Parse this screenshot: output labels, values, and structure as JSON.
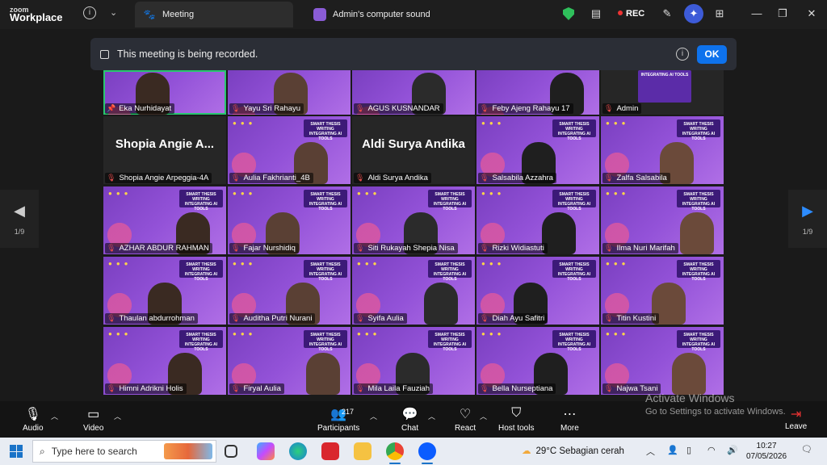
{
  "app": {
    "brand_small": "zoom",
    "brand": "Workplace"
  },
  "tabs": [
    {
      "label": "Meeting",
      "icon": "paw-icon",
      "active": true
    },
    {
      "label": "Admin's computer sound",
      "icon": "share-sound-icon",
      "active": false
    }
  ],
  "topbar": {
    "rec_label": "REC"
  },
  "recording_banner": {
    "message": "This meeting is being recorded.",
    "ok_label": "OK"
  },
  "pager": {
    "left": "1/9",
    "right": "1/9"
  },
  "tile_banner": "SMART THESIS WRITING INTEGRATING AI TOOLS",
  "participants": [
    {
      "name": "Eka Nurhidayat",
      "kind": "camera",
      "speaking": true,
      "pinned": true
    },
    {
      "name": "Yayu Sri Rahayu",
      "kind": "camera"
    },
    {
      "name": "AGUS KUSNANDAR",
      "kind": "camera"
    },
    {
      "name": "Feby Ajeng Rahayu 17",
      "kind": "camera"
    },
    {
      "name": "Admin",
      "kind": "poster",
      "poster_text": "INTEGRATING AI TOOLS"
    },
    {
      "name": "Shopia Angie Arpeggia-4A",
      "kind": "name-only",
      "display": "Shopia Angie A..."
    },
    {
      "name": "Aulia Fakhrianti_4B",
      "kind": "camera"
    },
    {
      "name": "Aldi Surya Andika",
      "kind": "name-only",
      "display": "Aldi Surya Andika"
    },
    {
      "name": "Salsabila Azzahra",
      "kind": "camera"
    },
    {
      "name": "Zalfa Salsabila",
      "kind": "camera"
    },
    {
      "name": "AZHAR ABDUR RAHMAN",
      "kind": "camera"
    },
    {
      "name": "Fajar Nurshidiq",
      "kind": "camera"
    },
    {
      "name": "Siti Rukayah Shepia Nisa",
      "kind": "camera"
    },
    {
      "name": "Rizki Widiastuti",
      "kind": "camera"
    },
    {
      "name": "Ilma Nuri Marifah",
      "kind": "camera"
    },
    {
      "name": "Thaulan abdurrohman",
      "kind": "camera"
    },
    {
      "name": "Auditha Putri Nurani",
      "kind": "camera"
    },
    {
      "name": "Syifa Aulia",
      "kind": "camera"
    },
    {
      "name": "Diah Ayu Safitri",
      "kind": "camera"
    },
    {
      "name": "Titin Kustini",
      "kind": "camera"
    },
    {
      "name": "Himni Adrikni Holis",
      "kind": "camera"
    },
    {
      "name": "Firyal Aulia",
      "kind": "camera"
    },
    {
      "name": "Mila Laila Fauziah",
      "kind": "camera"
    },
    {
      "name": "Bella Nurseptiana",
      "kind": "camera"
    },
    {
      "name": "Najwa Tsani",
      "kind": "camera"
    }
  ],
  "toolbar": {
    "audio": "Audio",
    "video": "Video",
    "participants": "Participants",
    "participants_count": "217",
    "chat": "Chat",
    "react": "React",
    "host_tools": "Host tools",
    "more": "More",
    "leave": "Leave"
  },
  "watermark": {
    "line1": "Activate Windows",
    "line2": "Go to Settings to activate Windows."
  },
  "taskbar": {
    "search_placeholder": "Type here to search",
    "weather": "29°C  Sebagian cerah",
    "time": "10:27",
    "date": "07/05/2026"
  },
  "colors": {
    "accent": "#0e72ed",
    "tile_purple": "#9352d8",
    "speaking": "#28c76f",
    "muted": "#e34a4a"
  }
}
